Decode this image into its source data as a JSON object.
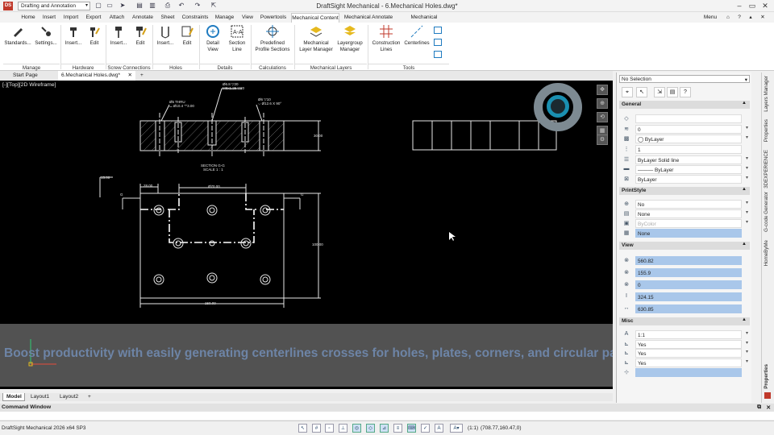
{
  "app": {
    "title": "DraftSight Mechanical - 6.Mechanical Holes.dwg*",
    "workspace": "Drafting and Annotation",
    "menu_label": "Menu"
  },
  "tabs": [
    "Home",
    "Insert",
    "Import",
    "Export",
    "Attach",
    "Annotate",
    "Sheet",
    "Constraints",
    "Manage",
    "View",
    "Powertools",
    "Mechanical Content",
    "Mechanical Annotate",
    "Mechanical Extensions"
  ],
  "active_tab": "Mechanical Content",
  "ribbon": {
    "buttons": [
      "Standards...",
      "Settings...",
      "Insert...",
      "Edit",
      "Insert...",
      "Edit",
      "Insert...",
      "Edit",
      "Detail View",
      "Section Line",
      "Predefined Profile Sections",
      "Mechanical Layer Manager",
      "Layergroup Manager",
      "Construction Lines",
      "Centerlines"
    ],
    "groups": [
      "Manage",
      "Hardware",
      "Screw Connections",
      "Holes",
      "Details",
      "Calculations",
      "Mechanical Layers",
      "Tools"
    ]
  },
  "doc_tabs": [
    "Start Page",
    "6.Mechanical Holes.dwg*"
  ],
  "viewport_label": "[-][Top][2D Wireframe]",
  "drawing": {
    "dim_top1": "Ø6.8 ▽20",
    "dim_top2": "M8x1.25 ▽20",
    "dim_left": "Ø5 THRU",
    "dim_left2": "⌴ Ø10.4 ▽3.00",
    "dim_right": "Ø6 ▽10",
    "dim_right2": "⌵ Ø12.6 X 90°",
    "dim_height": "30.00",
    "section": "SECTION G-G",
    "scale": "SCALE 1 : 1",
    "d15": "15.00",
    "d28": "28.00",
    "d70": "Ø70.00",
    "d100": "100.00",
    "d150": "150.00",
    "g": "G"
  },
  "banner_text": "Boost productivity with easily generating centerlines crosses for holes, plates, corners, and circular patterns faster",
  "layout_tabs": [
    "Model",
    "Layout1",
    "Layout2"
  ],
  "command_window": "Command Window",
  "status": {
    "version": "DraftSight Mechanical 2026  x64 SP3",
    "scale": "(1:1)",
    "coords": "(708.77,160.47,0)"
  },
  "properties": {
    "selection": "No Selection",
    "general_title": "General",
    "general": [
      {
        "icon": "color-icon",
        "value": ""
      },
      {
        "icon": "layer-icon",
        "value": "0"
      },
      {
        "icon": "linestyle-icon",
        "value": "◯ ByLayer"
      },
      {
        "icon": "scale-icon",
        "value": "1"
      },
      {
        "icon": "lineweight-icon",
        "value": "ByLayer     Solid line"
      },
      {
        "icon": "weight-icon",
        "value": "——— ByLayer"
      },
      {
        "icon": "transparency-icon",
        "value": "ByLayer"
      }
    ],
    "print_title": "PrintStyle",
    "print": [
      "No",
      "None",
      "ByColor",
      "None"
    ],
    "view_title": "View",
    "view": [
      "560.82",
      "155.9",
      "0",
      "324.15",
      "630.85"
    ],
    "misc_title": "Misc",
    "misc": [
      "1:1",
      "Yes",
      "Yes",
      "Yes",
      ""
    ]
  },
  "side_tabs": [
    "Layers Manager",
    "Properties",
    "3DEXPERIENCE",
    "G-code Generator",
    "HomeByMe",
    "Properties"
  ]
}
